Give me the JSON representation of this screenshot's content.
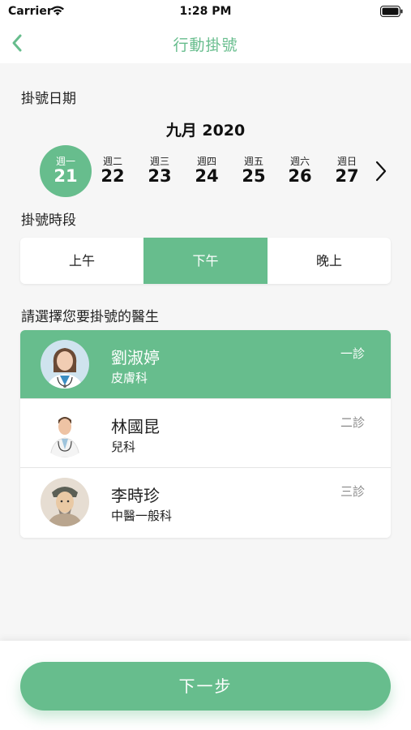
{
  "status_bar": {
    "carrier": "Carrier",
    "time": "1:28 PM"
  },
  "nav": {
    "title": "行動掛號",
    "back_icon": "chevron-left-icon"
  },
  "date_section": {
    "label": "掛號日期",
    "month": "九月 2020",
    "days": [
      {
        "weekday": "週一",
        "date": "21",
        "selected": true
      },
      {
        "weekday": "週二",
        "date": "22",
        "selected": false
      },
      {
        "weekday": "週三",
        "date": "23",
        "selected": false
      },
      {
        "weekday": "週四",
        "date": "24",
        "selected": false
      },
      {
        "weekday": "週五",
        "date": "25",
        "selected": false
      },
      {
        "weekday": "週六",
        "date": "26",
        "selected": false
      },
      {
        "weekday": "週日",
        "date": "27",
        "selected": false
      }
    ],
    "next_icon": "chevron-right-icon"
  },
  "period_section": {
    "label": "掛號時段",
    "options": [
      {
        "label": "上午",
        "selected": false
      },
      {
        "label": "下午",
        "selected": true
      },
      {
        "label": "晚上",
        "selected": false
      }
    ]
  },
  "doctor_section": {
    "label": "請選擇您要掛號的醫生",
    "doctors": [
      {
        "name": "劉淑婷",
        "department": "皮膚科",
        "room": "一診",
        "selected": true
      },
      {
        "name": "林國昆",
        "department": "兒科",
        "room": "二診",
        "selected": false
      },
      {
        "name": "李時珍",
        "department": "中醫一般科",
        "room": "三診",
        "selected": false
      }
    ]
  },
  "footer": {
    "next_label": "下一步"
  },
  "colors": {
    "accent": "#67bd8d",
    "background": "#f6f6f6",
    "card": "#ffffff"
  }
}
